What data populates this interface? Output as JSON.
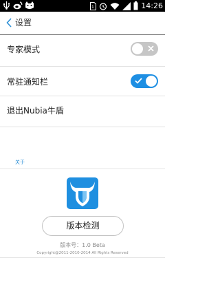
{
  "status_bar": {
    "time": "14:26",
    "left_icons": [
      "usb-icon",
      "weibo-icon",
      "cat-icon"
    ],
    "right_icons": [
      "sim-icon",
      "alarm-icon",
      "wifi-icon",
      "signal-icon",
      "battery-icon"
    ]
  },
  "header": {
    "title": "设置",
    "back_icon": "chevron-left-icon"
  },
  "settings": {
    "items": [
      {
        "label": "专家模式",
        "toggle": "off"
      },
      {
        "label": "常驻通知栏",
        "toggle": "on"
      },
      {
        "label": "退出Nubia牛盾"
      }
    ]
  },
  "about": {
    "label": "关于",
    "logo_icon": "nubia-shield-logo",
    "check_button": "版本检测",
    "version": "版本号：1.0 Beta",
    "copyright": "Copyright@2011-2010-2014 All Rights Reserved"
  },
  "colors": {
    "accent": "#1e8fe3",
    "toggle_off": "#c6c6c6",
    "logo_blue": "#1f8fe0",
    "link": "#2b8fd6"
  }
}
